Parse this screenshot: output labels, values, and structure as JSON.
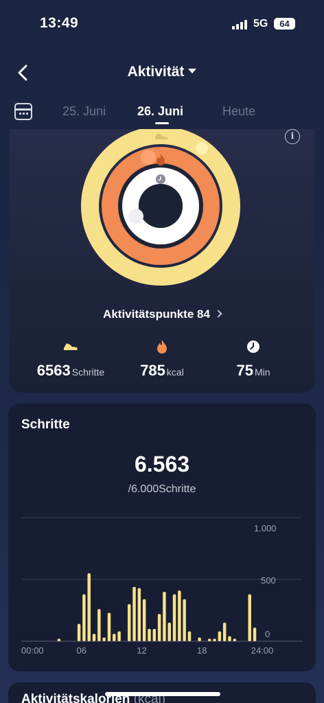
{
  "status": {
    "time": "13:49",
    "network": "5G",
    "battery": "64"
  },
  "nav": {
    "title": "Aktivität"
  },
  "dates": {
    "prev": "25. Juni",
    "current": "26. Juni",
    "next": "Heute"
  },
  "activity": {
    "points_label": "Aktivitätspunkte 84",
    "steps": {
      "value": "6563",
      "unit": "Schritte",
      "icon": "shoe-icon",
      "color": "#f7e08a"
    },
    "calories": {
      "value": "785",
      "unit": "kcal",
      "icon": "flame-icon",
      "color": "#f28b54"
    },
    "minutes": {
      "value": "75",
      "unit": "Min",
      "icon": "clock-icon",
      "color": "#ffffff"
    },
    "rings": {
      "steps_progress": 1.09,
      "calories_progress": 0.92,
      "minutes_progress": 0.88
    }
  },
  "steps_card": {
    "title": "Schritte",
    "value": "6.563",
    "goal": "/6.000Schritte"
  },
  "kcal_card": {
    "title": "Aktivitätskalorien",
    "unit": "(kcal)"
  },
  "chart_data": {
    "type": "bar",
    "x_ticks": [
      "00:00",
      "06",
      "12",
      "18",
      "24:00"
    ],
    "y_ticks": [
      "1.000",
      "500",
      "0"
    ],
    "ylim": [
      0,
      1000
    ],
    "bar_color": "#f7e08a",
    "values": [
      0,
      0,
      0,
      0,
      0,
      0,
      0,
      0,
      0,
      0,
      0,
      0,
      0,
      0,
      0,
      0,
      0,
      0,
      0,
      0,
      0,
      0,
      0,
      0,
      0,
      0,
      0,
      0,
      0,
      0,
      0,
      0,
      0,
      0,
      0,
      0,
      0,
      0,
      0,
      0,
      0,
      0,
      0,
      0,
      0,
      0,
      0,
      0,
      0,
      0,
      0,
      0,
      0,
      0,
      0,
      0,
      0,
      0,
      0,
      0,
      0,
      0,
      0,
      0,
      0,
      0,
      0,
      0,
      0,
      0,
      0,
      0,
      0,
      0,
      0,
      0,
      0,
      0,
      0,
      0,
      0,
      0,
      0,
      0,
      0,
      0,
      0,
      0,
      0,
      0,
      0,
      0,
      0,
      0,
      0,
      0,
      0,
      0,
      0,
      0,
      0,
      0,
      0,
      0,
      0,
      0,
      0,
      0,
      0,
      0,
      0,
      0,
      0,
      0,
      0,
      0,
      0,
      0,
      0,
      0,
      0,
      0,
      0,
      0,
      0,
      0,
      0,
      0,
      0,
      0,
      0,
      0,
      0,
      0,
      0,
      0,
      0,
      0,
      0,
      0,
      0,
      0,
      0,
      0,
      0,
      0,
      0,
      0,
      0,
      0,
      0,
      0,
      0,
      0,
      0,
      0,
      0,
      0,
      0,
      0,
      0,
      0,
      0,
      0,
      0,
      0,
      0,
      0,
      0,
      0,
      0,
      0,
      0,
      0,
      0,
      0,
      0,
      0,
      0,
      0,
      0,
      0,
      0,
      0,
      0,
      0,
      0,
      0,
      0,
      0,
      0,
      0,
      0,
      0,
      0,
      0,
      0,
      0,
      0,
      0,
      0,
      0,
      0,
      0,
      0,
      0,
      0,
      0,
      0,
      0,
      0,
      0,
      0,
      0,
      0,
      0,
      0,
      0,
      0,
      0,
      0,
      0,
      0,
      0,
      0,
      0,
      0,
      0,
      0,
      0,
      0,
      0,
      0,
      0,
      0,
      0,
      0,
      0,
      0,
      0
    ],
    "bars": [
      {
        "t": 3.75,
        "v": 20
      },
      {
        "t": 5.75,
        "v": 140
      },
      {
        "t": 6.25,
        "v": 380
      },
      {
        "t": 6.75,
        "v": 550
      },
      {
        "t": 7.25,
        "v": 60
      },
      {
        "t": 7.75,
        "v": 260
      },
      {
        "t": 8.25,
        "v": 30
      },
      {
        "t": 8.75,
        "v": 230
      },
      {
        "t": 9.25,
        "v": 60
      },
      {
        "t": 9.75,
        "v": 80
      },
      {
        "t": 10.75,
        "v": 300
      },
      {
        "t": 11.25,
        "v": 440
      },
      {
        "t": 11.75,
        "v": 430
      },
      {
        "t": 12.25,
        "v": 340
      },
      {
        "t": 12.75,
        "v": 100
      },
      {
        "t": 13.25,
        "v": 100
      },
      {
        "t": 13.75,
        "v": 220
      },
      {
        "t": 14.25,
        "v": 400
      },
      {
        "t": 14.75,
        "v": 150
      },
      {
        "t": 15.25,
        "v": 380
      },
      {
        "t": 15.75,
        "v": 410
      },
      {
        "t": 16.25,
        "v": 340
      },
      {
        "t": 16.75,
        "v": 80
      },
      {
        "t": 17.75,
        "v": 30
      },
      {
        "t": 18.75,
        "v": 20
      },
      {
        "t": 19.25,
        "v": 20
      },
      {
        "t": 19.75,
        "v": 80
      },
      {
        "t": 20.25,
        "v": 150
      },
      {
        "t": 20.75,
        "v": 40
      },
      {
        "t": 21.25,
        "v": 20
      },
      {
        "t": 22.75,
        "v": 380
      },
      {
        "t": 23.25,
        "v": 110
      }
    ]
  }
}
